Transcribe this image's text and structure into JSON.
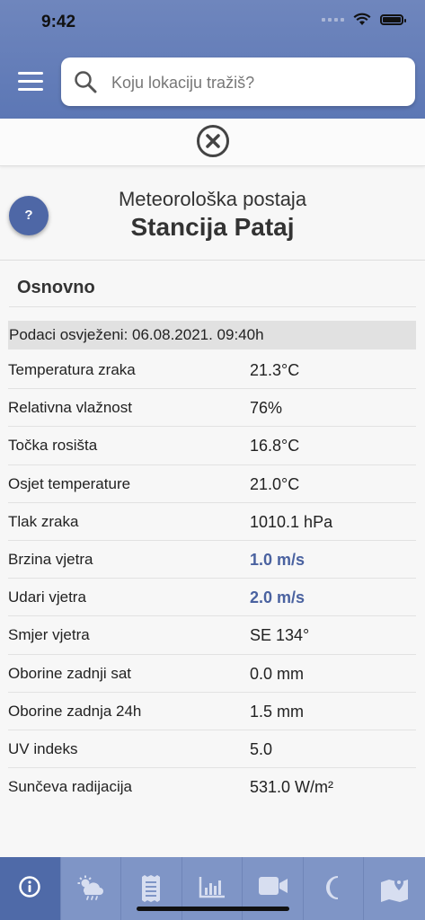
{
  "status_bar": {
    "time": "9:42"
  },
  "search": {
    "placeholder": "Koju lokaciju tražiš?"
  },
  "station": {
    "type": "Meteorološka postaja",
    "name": "Stancija Pataj"
  },
  "help": {
    "label": "?"
  },
  "section": {
    "title": "Osnovno",
    "refresh_text": "Podaci osvježeni: 06.08.2021. 09:40h",
    "rows": [
      {
        "label": "Temperatura zraka",
        "value": "21.3°C"
      },
      {
        "label": "Relativna vlažnost",
        "value": "76%"
      },
      {
        "label": "Točka rosišta",
        "value": "16.8°C"
      },
      {
        "label": "Osjet temperature",
        "value": "21.0°C"
      },
      {
        "label": "Tlak zraka",
        "value": "1010.1 hPa"
      },
      {
        "label": "Brzina vjetra",
        "value": "1.0 m/s"
      },
      {
        "label": "Udari vjetra",
        "value": "2.0 m/s"
      },
      {
        "label": "Smjer vjetra",
        "value": "SE 134°"
      },
      {
        "label": "Oborine zadnji sat",
        "value": "0.0 mm"
      },
      {
        "label": "Oborine zadnja 24h",
        "value": "1.5 mm"
      },
      {
        "label": "UV indeks",
        "value": "5.0"
      },
      {
        "label": "Sunčeva radijacija",
        "value": "531.0 W/m²"
      }
    ]
  },
  "tabbar": {
    "tabs": [
      "info-icon",
      "weather-icon",
      "receipt-icon",
      "chart-icon",
      "video-camera-icon",
      "moon-icon",
      "map-icon"
    ],
    "active_index": 0
  },
  "colors": {
    "header": "#5c77b5",
    "tabbar": "#7f95c6",
    "accent": "#4a62a0",
    "active_tab": "#4f6aa8"
  }
}
